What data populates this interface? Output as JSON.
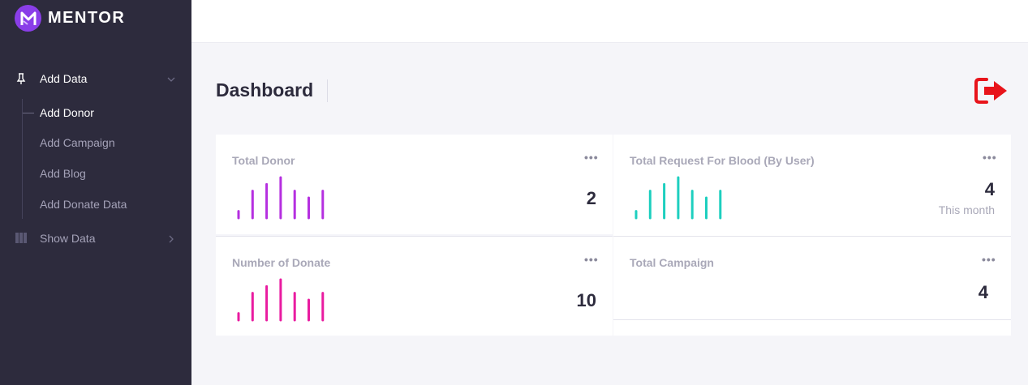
{
  "brand": {
    "name": "MENTOR",
    "logo_color": "#8a3ee8"
  },
  "sidebar": {
    "sections": [
      {
        "label": "Add Data",
        "icon": "pin-icon",
        "expanded": true,
        "items": [
          {
            "label": "Add Donor",
            "active": true
          },
          {
            "label": "Add Campaign",
            "active": false
          },
          {
            "label": "Add Blog",
            "active": false
          },
          {
            "label": "Add Donate Data",
            "active": false
          }
        ]
      },
      {
        "label": "Show Data",
        "icon": "columns-icon",
        "expanded": false
      }
    ]
  },
  "page": {
    "title": "Dashboard"
  },
  "cards": [
    {
      "title": "Total Donor",
      "value": "2",
      "sub": "",
      "color": "#b52fe0",
      "bars": [
        1,
        4,
        5,
        6,
        4,
        3,
        4
      ]
    },
    {
      "title": "Total Request For Blood (By User)",
      "value": "4",
      "sub": "This month",
      "color": "#1dcfbf",
      "bars": [
        1,
        4,
        5,
        6,
        4,
        3,
        4
      ]
    },
    {
      "title": "Number of Donate",
      "value": "10",
      "sub": "",
      "color": "#e91ba0",
      "bars": [
        1,
        4,
        5,
        6,
        4,
        3,
        4
      ]
    },
    {
      "title": "Total Campaign",
      "value": "4",
      "sub": ""
    }
  ],
  "colors": {
    "sidebar_bg": "#2d2b3d",
    "logout": "#e8141b"
  }
}
